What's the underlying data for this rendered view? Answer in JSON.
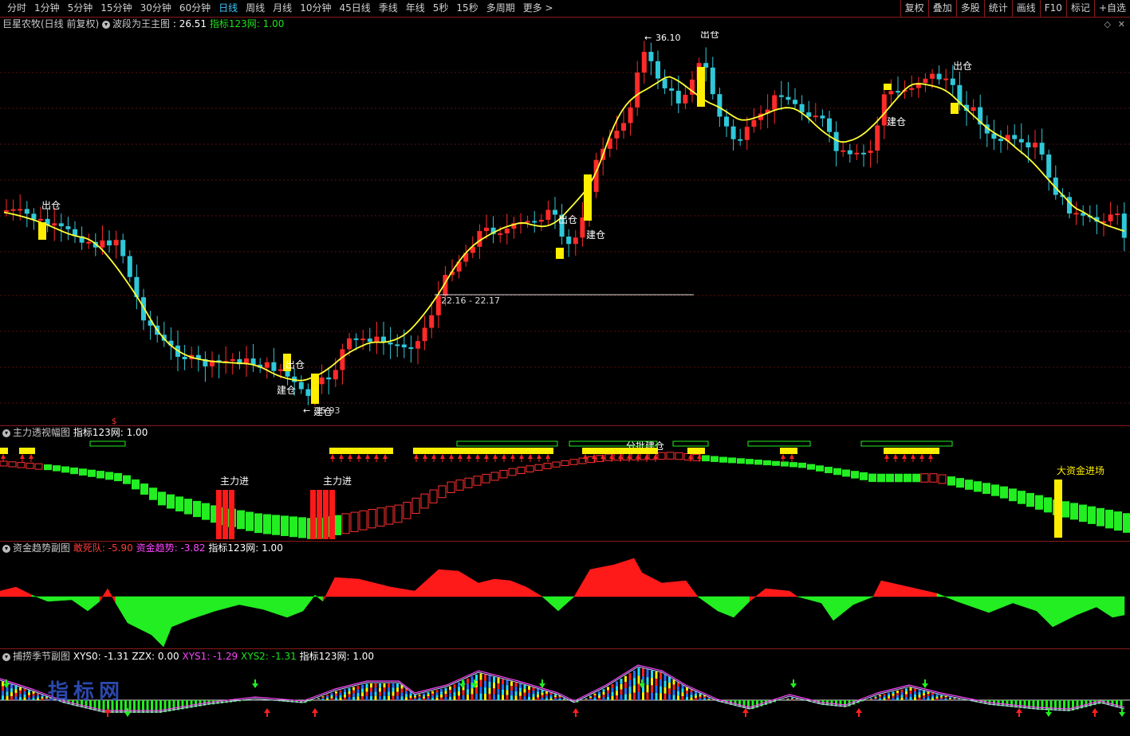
{
  "toolbar": {
    "periods": [
      "分时",
      "1分钟",
      "5分钟",
      "15分钟",
      "30分钟",
      "60分钟",
      "日线",
      "周线",
      "月线",
      "10分钟",
      "45日线",
      "季线",
      "年线",
      "5秒",
      "15秒",
      "多周期",
      "更多 >"
    ],
    "active_period": "日线",
    "tools": [
      "复权",
      "叠加",
      "多股",
      "统计",
      "画线",
      "F10",
      "标记",
      "+自选"
    ]
  },
  "main_panel": {
    "stock": "巨星农牧(日线 前复权)",
    "indicator": "波段为王主图",
    "indicator_value": ": 26.51",
    "net_label": "指标123网: 1.00",
    "high_label": "36.10",
    "low_label": "15.93",
    "range_label": "22.16 - 22.17",
    "jiancang": "建仓",
    "chucang": "出仓",
    "top_label": "出仓"
  },
  "panel2": {
    "title": "主力透视幅图",
    "net_label": "指标123网: 1.00",
    "zhulijin": "主力进",
    "dazijin": "大资金进场",
    "fenpi": "分批建仓"
  },
  "panel3": {
    "title": "资金趋势副图",
    "label1": "敢死队: -5.90",
    "label2": "资金趋势: -3.82",
    "net_label": "指标123网: 1.00"
  },
  "panel4": {
    "title": "捕捞季节副图",
    "xys0": "XYS0: -1.31",
    "zzx": "ZZX: 0.00",
    "xys1": "XYS1: -1.29",
    "xys2": "XYS2: -1.31",
    "net_label": "指标123网: 1.00"
  },
  "watermark": "指标网",
  "colors": {
    "up": "#ff2a2a",
    "down": "#30c8d8",
    "ma": "#ffff33",
    "yellow": "#ffee00",
    "green": "#22ee22",
    "panel_border": "#8a1a1a"
  }
}
